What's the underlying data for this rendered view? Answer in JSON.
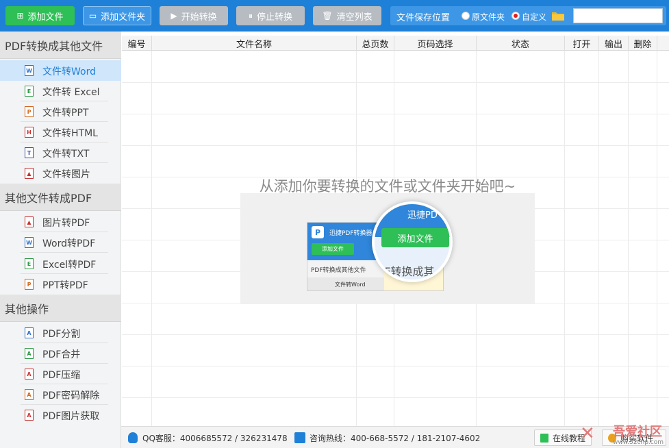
{
  "toolbar": {
    "add_file": "添加文件",
    "add_folder": "添加文件夹",
    "start": "开始转换",
    "stop": "停止转换",
    "clear": "清空列表",
    "save_location_label": "文件保存位置",
    "radio_original": "原文件夹",
    "radio_custom": "自定义",
    "selected_save_option": "自定义",
    "path_value": ""
  },
  "sidebar": {
    "section1": "PDF转换成其他文件",
    "pdf_to_other": [
      {
        "label": "文件转Word",
        "icon": "word-file-icon",
        "glyph": "W"
      },
      {
        "label": "文件转 Excel",
        "icon": "excel-file-icon",
        "glyph": "E"
      },
      {
        "label": "文件转PPT",
        "icon": "ppt-file-icon",
        "glyph": "P"
      },
      {
        "label": "文件转HTML",
        "icon": "html-file-icon",
        "glyph": "H"
      },
      {
        "label": "文件转TXT",
        "icon": "txt-file-icon",
        "glyph": "T"
      },
      {
        "label": "文件转图片",
        "icon": "image-file-icon",
        "glyph": "▲"
      }
    ],
    "section2": "其他文件转成PDF",
    "other_to_pdf": [
      {
        "label": "图片转PDF",
        "icon": "image-file-icon",
        "glyph": "▲"
      },
      {
        "label": "Word转PDF",
        "icon": "word-file-icon",
        "glyph": "W"
      },
      {
        "label": "Excel转PDF",
        "icon": "excel-file-icon",
        "glyph": "E"
      },
      {
        "label": "PPT转PDF",
        "icon": "ppt-file-icon",
        "glyph": "P"
      }
    ],
    "section3": "其他操作",
    "other_ops": [
      {
        "label": "PDF分割",
        "icon": "pdf-file-icon",
        "glyph": "A"
      },
      {
        "label": "PDF合并",
        "icon": "pdf-file-icon",
        "glyph": "A"
      },
      {
        "label": "PDF压缩",
        "icon": "pdf-file-icon",
        "glyph": "A"
      },
      {
        "label": "PDF密码解除",
        "icon": "pdf-file-icon",
        "glyph": "A"
      },
      {
        "label": "PDF图片获取",
        "icon": "pdf-file-icon",
        "glyph": "A"
      }
    ],
    "active_item": "文件转Word"
  },
  "table": {
    "columns": [
      "编号",
      "文件名称",
      "总页数",
      "页码选择",
      "状态",
      "打开",
      "输出",
      "删除"
    ]
  },
  "empty_state": {
    "message": "从添加你要转换的文件或文件夹开始吧~",
    "demo_title": "迅捷PDF转换器",
    "demo_add_button": "添加文件",
    "demo_section": "PDF转换成其他文件",
    "demo_item": "文件转Word",
    "lens_title": "迅捷PD",
    "lens_button": "添加文件",
    "lens_sub": "DF转换成其"
  },
  "statusbar": {
    "qq": "QQ客服：4006685572 / 326231478",
    "hotline": "咨询热线：400-668-5572 / 181-2107-4602",
    "online_tutorial": "在线教程",
    "buy": "购买软件"
  },
  "watermark": {
    "text": "吾爱社区",
    "url": "www.52cnp.com"
  },
  "colors": {
    "toolbar_bg": "#1f80d8",
    "add_green": "#2fbf57",
    "disabled_gray": "#b6bcc2",
    "active_item_bg": "#cfe6fb",
    "accent_blue": "#1f80d8"
  }
}
